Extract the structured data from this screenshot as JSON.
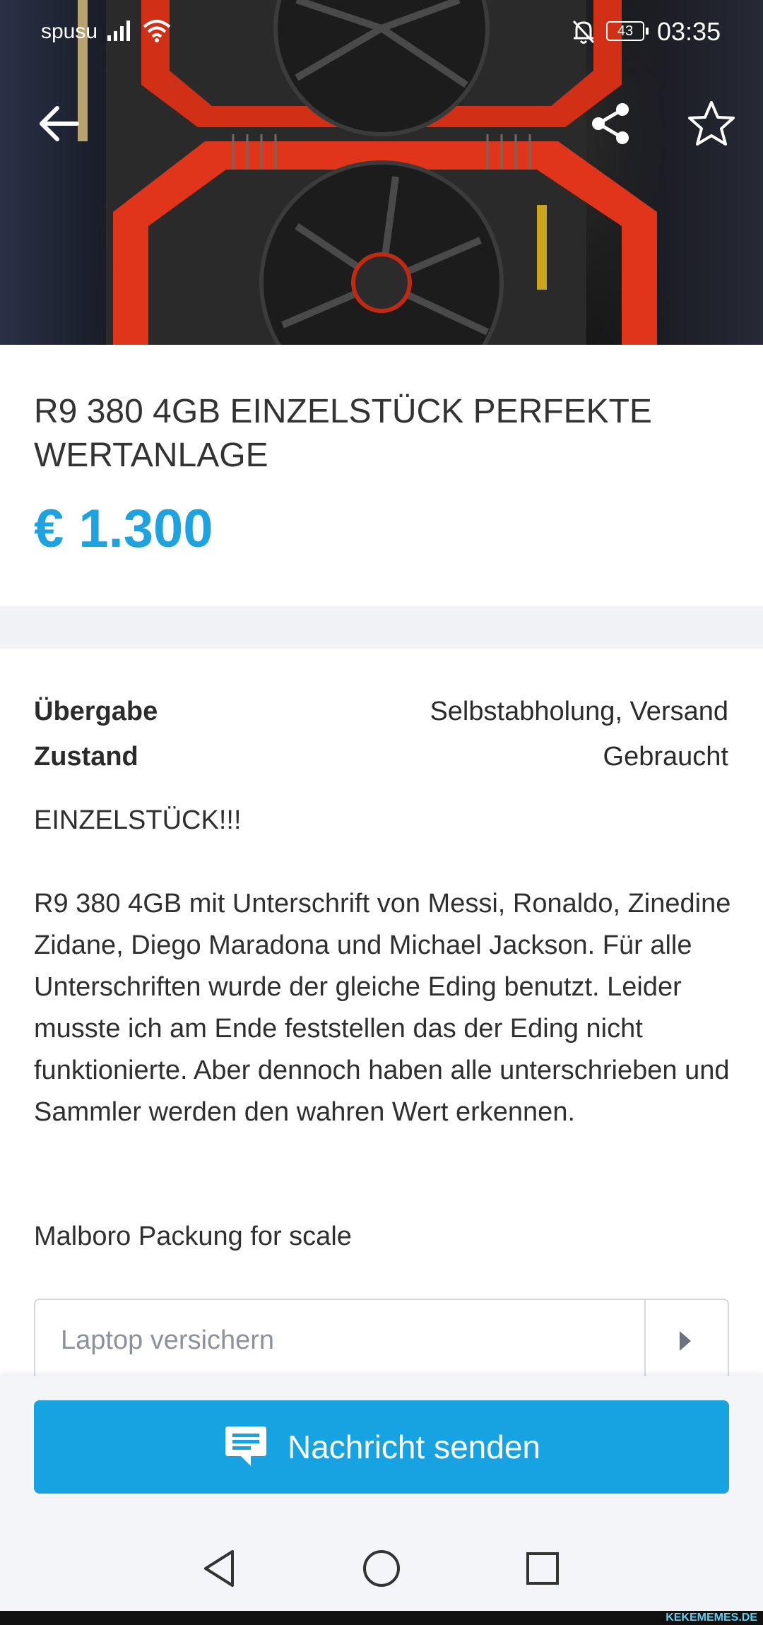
{
  "status_bar": {
    "carrier": "spusu",
    "battery": "43",
    "time": "03:35"
  },
  "listing": {
    "title": "R9 380 4GB EINZELSTÜCK PERFEKTE WERTANLAGE",
    "price": "€ 1.300"
  },
  "attributes": [
    {
      "label": "Übergabe",
      "value": "Selbstabholung, Versand"
    },
    {
      "label": "Zustand",
      "value": "Gebraucht"
    }
  ],
  "description": {
    "headline": "EINZELSTÜCK!!!",
    "body": "R9 380 4GB mit Unterschrift von Messi, Ronaldo, Zinedine Zidane, Diego Maradona und Michael Jackson. Für alle Unterschriften wurde der gleiche Eding benutzt. Leider musste ich am Ende feststellen das der Eding nicht funktionierte. Aber dennoch haben alle unterschrieben und Sammler werden den wahren Wert erkennen.",
    "footer": "Malboro Packung for scale"
  },
  "insurance": {
    "placeholder": "Laptop versichern"
  },
  "actions": {
    "send_label": "Nachricht senden"
  },
  "watermark": "KEKEMEMES.DE",
  "icons": {
    "back": "arrow-left-icon",
    "share": "share-icon",
    "favorite": "star-icon",
    "message": "chat-bubble-icon"
  },
  "colors": {
    "accent": "#17a3e1",
    "price": "#1ea2e0",
    "separator": "#f1f2f6"
  }
}
